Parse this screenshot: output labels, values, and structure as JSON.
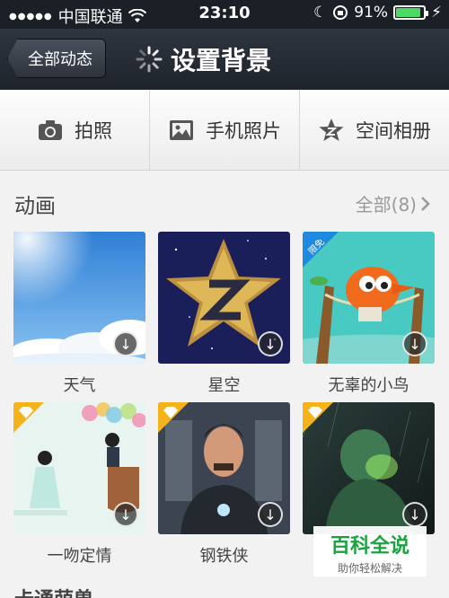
{
  "status_bar": {
    "carrier": "中国联通",
    "time": "23:10",
    "battery_percent": "91%",
    "battery_level": 0.91
  },
  "nav": {
    "back_label": "全部动态",
    "title": "设置背景"
  },
  "sources": [
    {
      "label": "拍照",
      "icon": "camera-icon"
    },
    {
      "label": "手机照片",
      "icon": "photo-icon"
    },
    {
      "label": "空间相册",
      "icon": "qzone-star-icon"
    }
  ],
  "section": {
    "title": "动画",
    "more_label": "全部(8)"
  },
  "themes": [
    {
      "caption": "天气",
      "badge": ""
    },
    {
      "caption": "星空",
      "badge": ""
    },
    {
      "caption": "无辜的小鸟",
      "badge": "限免"
    },
    {
      "caption": "一吻定情",
      "badge": "vip"
    },
    {
      "caption": "钢铁侠",
      "badge": "vip"
    },
    {
      "caption": "",
      "badge": "vip"
    }
  ],
  "watermark": {
    "title": "百科全说",
    "subtitle": "助你轻松解决"
  },
  "next_section": {
    "title": "卡通萌兽"
  },
  "colors": {
    "status_bg": "#1b1f26",
    "battery_green": "#4cd964",
    "watermark_green": "#1aa33e",
    "badge_blue": "#1e8be0",
    "badge_gold": "#f5b21b"
  }
}
